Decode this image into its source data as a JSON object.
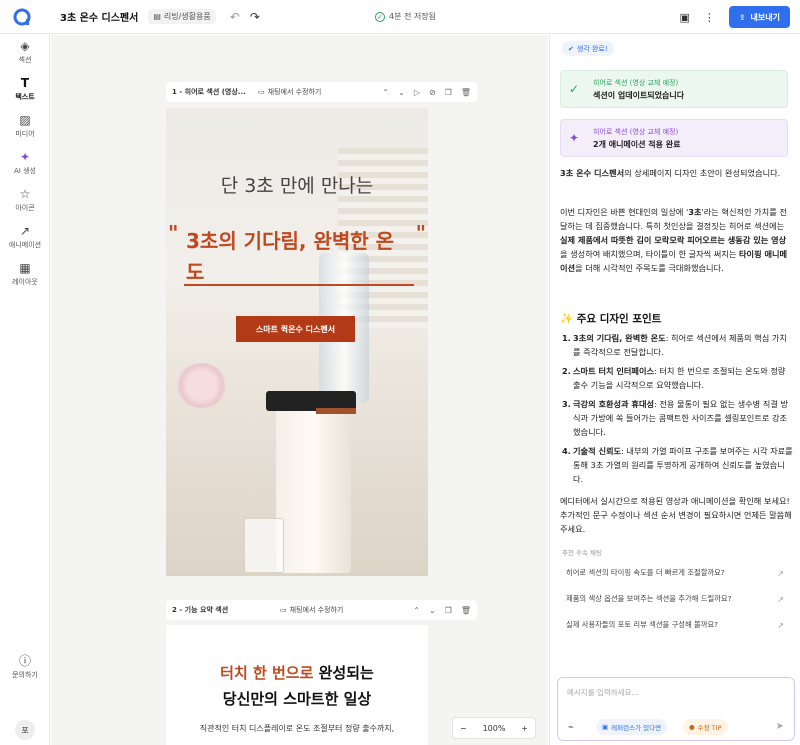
{
  "header": {
    "title": "3초 온수 디스펜서",
    "tag": "리빙/생활용품",
    "saved_status": "4분 전 저장됨",
    "export_label": "내보내기"
  },
  "sidebar": {
    "items": [
      {
        "label": "섹션",
        "icon": "layers-icon"
      },
      {
        "label": "텍스트",
        "icon": "text-icon"
      },
      {
        "label": "미디어",
        "icon": "image-icon"
      },
      {
        "label": "AI 생성",
        "icon": "magic-wand-icon"
      },
      {
        "label": "아이콘",
        "icon": "star-icon"
      },
      {
        "label": "애니메이션",
        "icon": "animation-icon"
      },
      {
        "label": "레이아웃",
        "icon": "grid-icon"
      }
    ],
    "help_label": "문의하기",
    "avatar_initial": "포"
  },
  "canvas": {
    "section1": {
      "label": "1 - 히어로 섹션 (영상...",
      "chat_edit": "채팅에서 수정하기",
      "headline": "단 3초 만에 만나는",
      "quote_open": "\"",
      "quote_close": "\"",
      "highlight": "3초의 기다림, 완벽한 온도",
      "cta_prefix": "스마트 퀵 ",
      "cta_bold": "온수 디스펜서"
    },
    "section2": {
      "label": "2 - 기능 요약 섹션",
      "chat_edit": "채팅에서 수정하기",
      "line1_highlight": "터치 한 번으로",
      "line1_rest": " 완성되는",
      "line2": "당신만의 스마트한 일상",
      "line3": "직관적인 터치 디스플레이로 온도 조절부터 정량 출수까지,"
    },
    "zoom": "100%"
  },
  "panel": {
    "done_badge": "생각 완료!",
    "card1": {
      "sub": "히어로 섹션 (영상 교체 예정)",
      "main": "섹션이 업데이트되었습니다"
    },
    "card2": {
      "sub": "히어로 섹션 (영상 교체 예정)",
      "main": "2개 애니메이션 적용 완료"
    },
    "p1": {
      "bold": "3초 온수 디스펜서",
      "rest": "의 상세페이지 디자인 초안이 완성되었습니다."
    },
    "p2": {
      "a": "이번 디자인은 바쁜 현대인의 일상에 '",
      "b": "3초",
      "c": "'라는 혁신적인 가치를 전달하는 데 집중했습니다. 특히 첫인상을 결정짓는 히어로 섹션에는 ",
      "d": "실제 제품에서 따뜻한 김이 모락모락 피어오르는 생동감 있는 영상",
      "e": "을 생성하여 배치했으며, 타이틀이 한 글자씩 써지는 ",
      "f": "타이핑 애니메이션",
      "g": "을 더해 시각적인 주목도를 극대화했습니다."
    },
    "points_heading": "✨ 주요 디자인 포인트",
    "points": [
      {
        "num": "1.",
        "title": "3초의 기다림, 완벽한 온도",
        "desc": ": 히어로 섹션에서 제품의 핵심 가치를 즉각적으로 전달합니다."
      },
      {
        "num": "2.",
        "title": "스마트 터치 인터페이스",
        "desc": ": 터치 한 번으로 조절되는 온도와 정량 출수 기능을 시각적으로 요약했습니다."
      },
      {
        "num": "3.",
        "title": "극강의 호환성과 휴대성",
        "desc": ": 전용 물통이 필요 없는 생수병 직결 방식과 가방에 쏙 들어가는 콤팩트한 사이즈를 셀링포인트로 강조했습니다."
      },
      {
        "num": "4.",
        "title": "기술적 신뢰도",
        "desc": ": 내부의 가열 파이프 구조를 보여주는 시각 자료를 통해 3초 가열의 원리를 투명하게 공개하여 신뢰도를 높였습니다."
      }
    ],
    "p3": "에디터에서 실시간으로 적용된 영상과 애니메이션을 확인해 보세요! 추가적인 문구 수정이나 섹션 순서 변경이 필요하시면 언제든 말씀해 주세요.",
    "suggestions_heading": "추천 후속 채팅",
    "suggestions": [
      "히어로 섹션의 타이핑 속도를 더 빠르게 조절할까요?",
      "제품의 색상 옵션을 보여주는 섹션을 추가해 드릴까요?",
      "실제 사용자들의 포토 리뷰 섹션을 구성해 볼까요?"
    ],
    "input_placeholder": "메시지를 입력하세요...",
    "chip_reference": "레퍼런스가 있다면",
    "chip_tip": "수정 TIP"
  },
  "colors": {
    "accent": "#2f6fed",
    "brand_red": "#c0481e",
    "success": "#2aa35a",
    "purple": "#8a4fd0"
  }
}
